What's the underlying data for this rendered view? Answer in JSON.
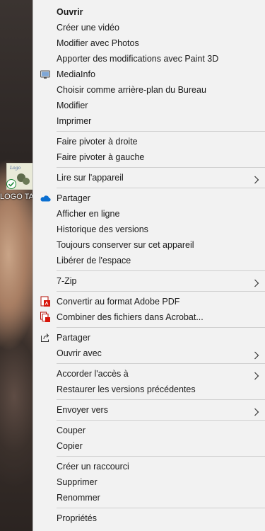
{
  "desktop_icon": {
    "label": "LOGO TAIMAG"
  },
  "menu": {
    "groups": [
      [
        {
          "label": "Ouvrir",
          "bold": true
        },
        {
          "label": "Créer une vidéo"
        },
        {
          "label": "Modifier avec Photos"
        },
        {
          "label": "Apporter des modifications avec Paint 3D"
        },
        {
          "label": "MediaInfo",
          "icon": "mediainfo-icon"
        },
        {
          "label": "Choisir comme arrière-plan du Bureau"
        },
        {
          "label": "Modifier"
        },
        {
          "label": "Imprimer"
        }
      ],
      [
        {
          "label": "Faire pivoter à droite"
        },
        {
          "label": "Faire pivoter à gauche"
        }
      ],
      [
        {
          "label": "Lire sur l'appareil",
          "submenu": true
        }
      ],
      [
        {
          "label": "Partager",
          "icon": "onedrive-cloud-icon"
        },
        {
          "label": "Afficher en ligne"
        },
        {
          "label": "Historique des versions"
        },
        {
          "label": "Toujours conserver sur cet appareil"
        },
        {
          "label": "Libérer de l'espace"
        }
      ],
      [
        {
          "label": "7-Zip",
          "submenu": true
        }
      ],
      [
        {
          "label": "Convertir au format Adobe PDF",
          "icon": "adobe-pdf-icon"
        },
        {
          "label": "Combiner des fichiers dans Acrobat...",
          "icon": "acrobat-combine-icon"
        }
      ],
      [
        {
          "label": "Partager",
          "icon": "share-icon"
        },
        {
          "label": "Ouvrir avec",
          "submenu": true
        }
      ],
      [
        {
          "label": "Accorder l'accès à",
          "submenu": true
        },
        {
          "label": "Restaurer les versions précédentes"
        }
      ],
      [
        {
          "label": "Envoyer vers",
          "submenu": true
        }
      ],
      [
        {
          "label": "Couper"
        },
        {
          "label": "Copier"
        }
      ],
      [
        {
          "label": "Créer un raccourci"
        },
        {
          "label": "Supprimer"
        },
        {
          "label": "Renommer"
        }
      ],
      [
        {
          "label": "Propriétés"
        }
      ]
    ]
  }
}
